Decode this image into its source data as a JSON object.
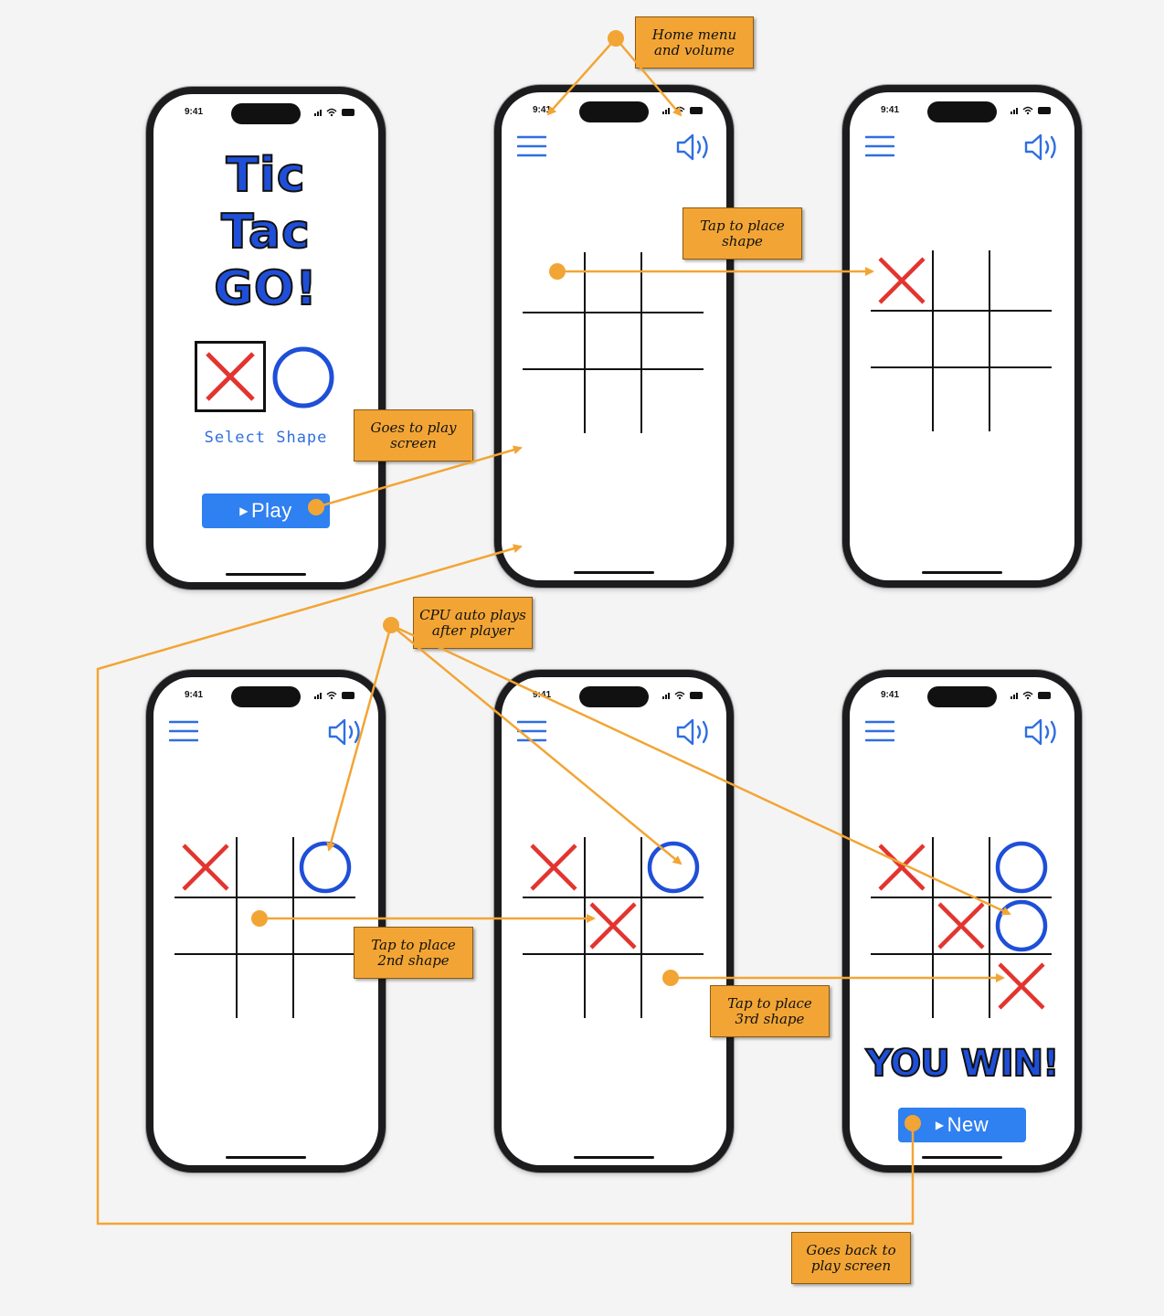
{
  "status_bar": {
    "time": "9:41"
  },
  "home": {
    "title_lines": [
      "Tic",
      "Tac",
      "GO!"
    ],
    "select_shape_label": "Select Shape",
    "play_button_label": "Play",
    "selected_shape": "x"
  },
  "win_screen": {
    "win_text": "YOU WIN!",
    "new_button_label": "New"
  },
  "boards": [
    [
      "",
      "",
      "",
      "",
      "",
      "",
      "",
      "",
      ""
    ],
    [
      "x",
      "",
      "",
      "",
      "",
      "",
      "",
      "",
      ""
    ],
    [
      "x",
      "",
      "o",
      "",
      "",
      "",
      "",
      "",
      ""
    ],
    [
      "x",
      "",
      "o",
      "",
      "x",
      "",
      "",
      "",
      ""
    ],
    [
      "x",
      "",
      "o",
      "",
      "x",
      "o",
      "",
      "",
      "x"
    ]
  ],
  "annotations": {
    "home_menu_volume": [
      "Home menu",
      "and volume"
    ],
    "tap_place_shape": [
      "Tap to place",
      "shape"
    ],
    "goes_to_play": [
      "Goes to play",
      "screen"
    ],
    "cpu_auto_plays": [
      "CPU auto plays",
      "after player"
    ],
    "tap_place_2nd": [
      "Tap to place",
      "2nd shape"
    ],
    "tap_place_3rd": [
      "Tap to place",
      "3rd shape"
    ],
    "goes_back": [
      "Goes back to",
      "play screen"
    ]
  },
  "colors": {
    "accent_blue": "#1f4fd8",
    "button_blue": "#2f80f0",
    "x_red": "#e3342f",
    "o_blue": "#1f4fd8",
    "annotation_orange": "#f2a535",
    "connector_orange": "#f2a535"
  },
  "icons": [
    "menu-icon",
    "volume-icon",
    "x-mark-icon",
    "o-mark-icon",
    "play-triangle-icon",
    "signal-icon",
    "wifi-icon",
    "battery-icon"
  ]
}
